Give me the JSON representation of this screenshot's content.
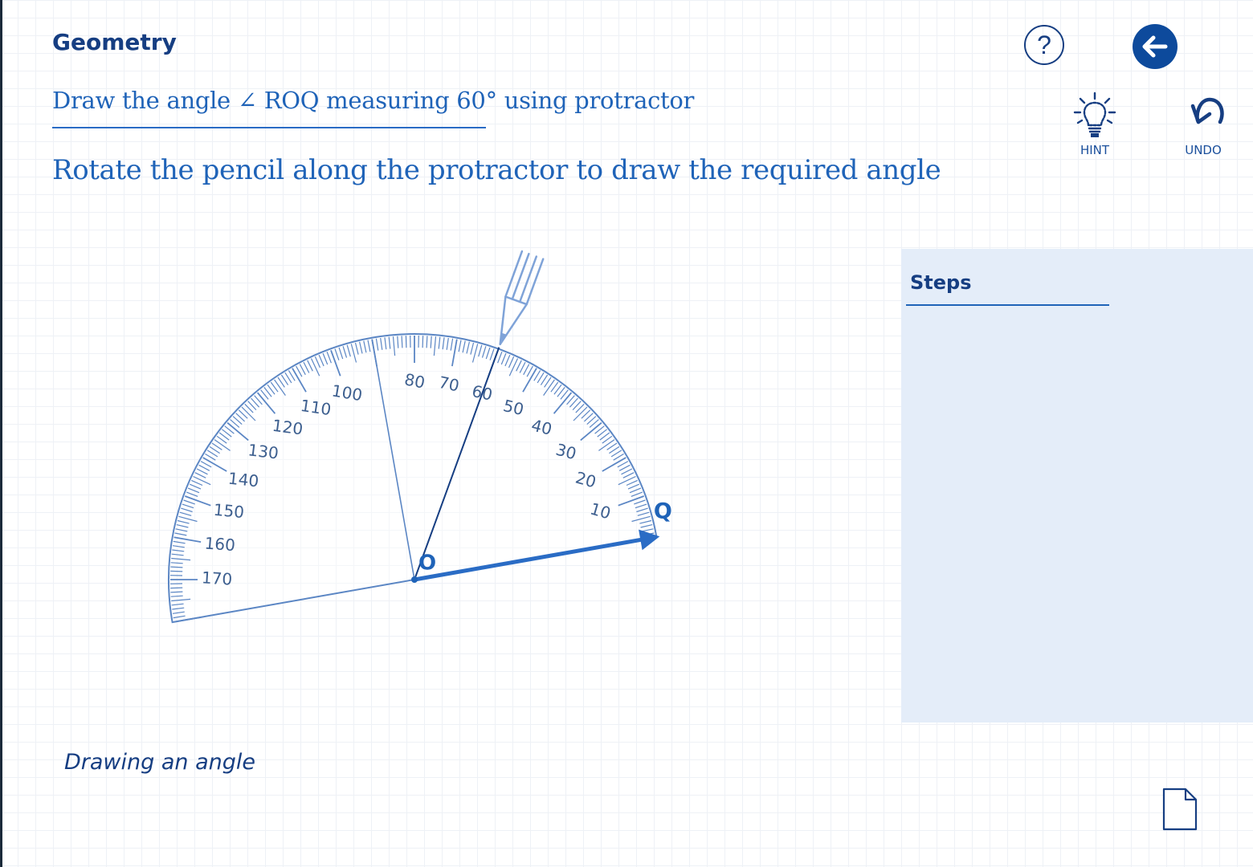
{
  "header": {
    "title": "Geometry",
    "question": "Draw the angle ∠ ROQ measuring 60°  using protractor",
    "instruction": "Rotate the pencil along the protractor to draw the required angle"
  },
  "toolbar": {
    "help_icon": "question-mark-icon",
    "back_icon": "arrow-left-icon",
    "hint_label": "HINT",
    "undo_label": "UNDO"
  },
  "protractor": {
    "scale_labels": [
      "10",
      "20",
      "30",
      "40",
      "50",
      "60",
      "70",
      "80",
      "100",
      "110",
      "120",
      "130",
      "140",
      "150",
      "160",
      "170"
    ],
    "point_o_label": "O",
    "point_q_label": "Q",
    "pencil_reading_deg": 60,
    "baseline_angle_deg": 10
  },
  "steps": {
    "title": "Steps"
  },
  "footer": {
    "caption": "Drawing an angle",
    "document_icon": "document-icon"
  },
  "colors": {
    "primary": "#163e82",
    "accent": "#2a6cc5",
    "protractor": "#5b86c4",
    "panel": "#e4edf9"
  }
}
